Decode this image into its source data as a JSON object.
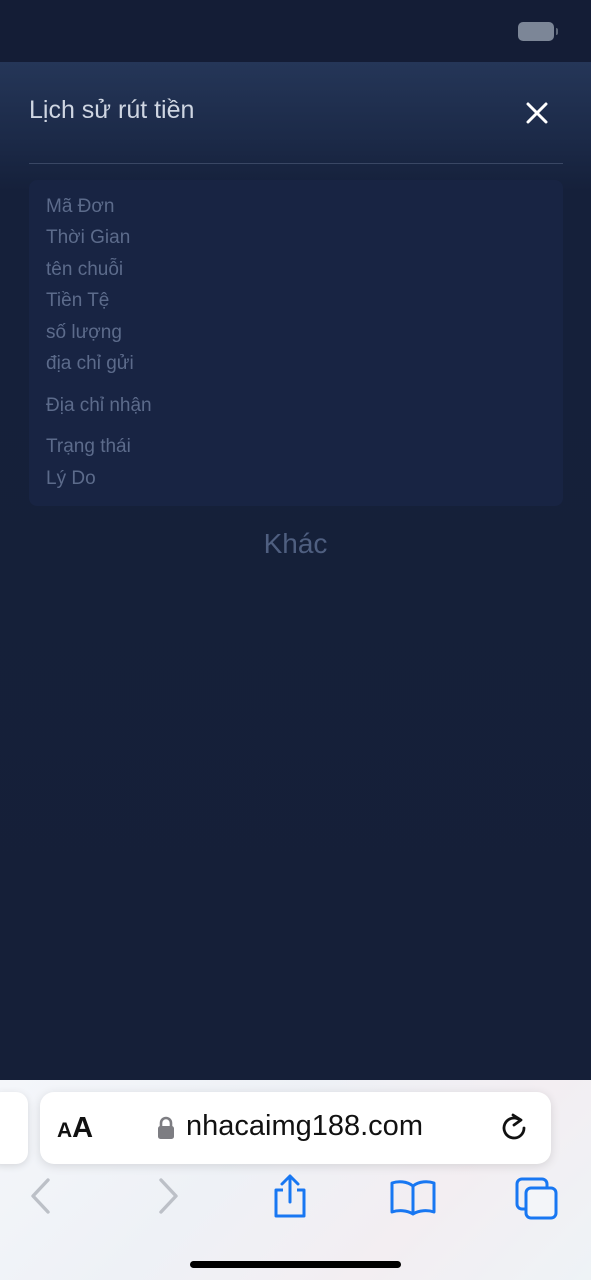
{
  "modal": {
    "title": "Lịch sử rút tiền",
    "fields": [
      "Mã Đơn",
      "Thời Gian",
      "tên chuỗi",
      "Tiền Tệ",
      "số lượng",
      "địa chỉ gửi",
      "Địa chỉ nhận",
      "Trạng thái",
      "Lý Do"
    ],
    "other_button": "Khác"
  },
  "browser": {
    "text_size_small": "A",
    "text_size_big": "A",
    "url": "nhacaimg188.com"
  },
  "colors": {
    "background": "#151f38",
    "card": "#182443",
    "field_text": "#5c6b8b",
    "ios_blue": "#1877f2"
  },
  "icons": {
    "close": "close-icon",
    "lock": "lock-icon",
    "reload": "reload-icon",
    "back": "chevron-left-icon",
    "forward": "chevron-right-icon",
    "share": "share-icon",
    "bookmarks": "book-icon",
    "tabs": "tabs-icon"
  }
}
